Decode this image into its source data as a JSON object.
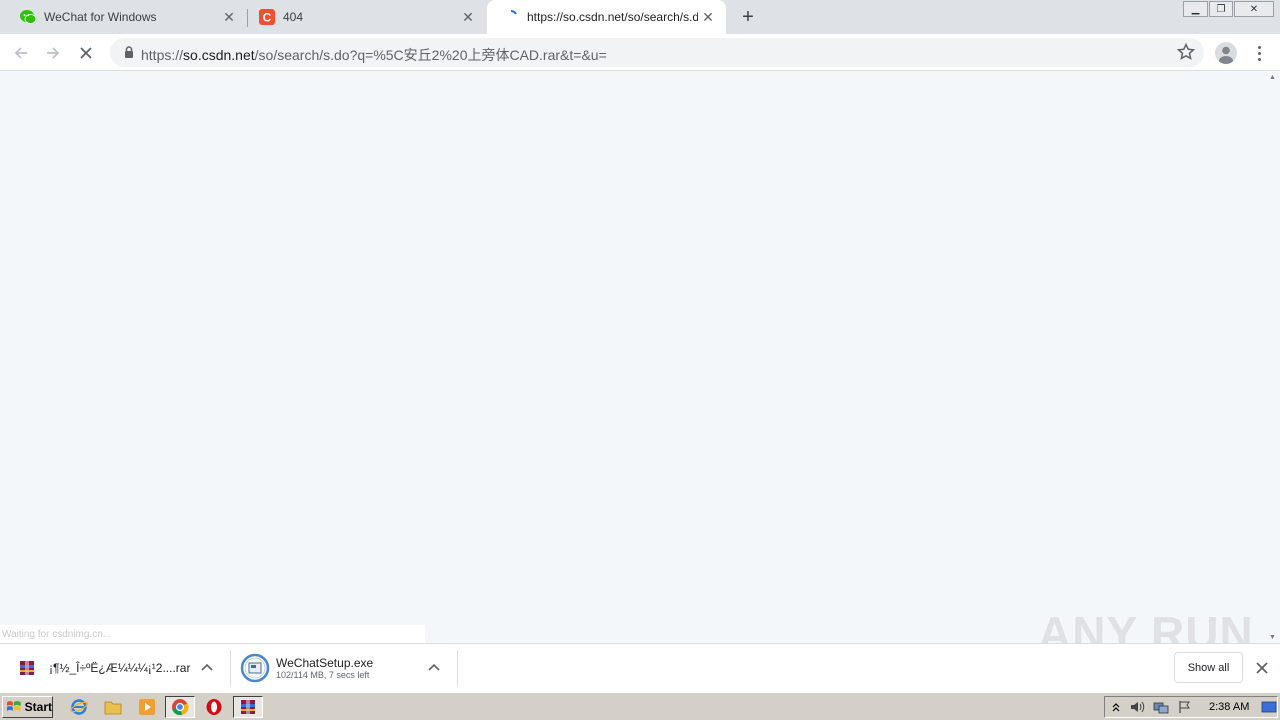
{
  "browser": {
    "tabs": [
      {
        "title": "WeChat for Windows",
        "favicon": "wechat-icon"
      },
      {
        "title": "404",
        "favicon": "csdn-icon"
      },
      {
        "title": "https://so.csdn.net/so/search/s.do?",
        "favicon": "loading-icon"
      }
    ],
    "address": {
      "scheme": "https://",
      "host": "so.csdn.net",
      "path": "/so/search/s.do?q=%5C安丘2%20上旁体CAD.rar&t=&u="
    },
    "status_text": "Waiting for csdnimg.cn..."
  },
  "downloads": {
    "items": [
      {
        "name": "¡¶½_Î÷ºË¿Æ¼¼¼¡¹2....rar",
        "sub": "",
        "icon": "winrar-icon"
      },
      {
        "name": "WeChatSetup.exe",
        "sub": "102/114 MB, 7 secs left",
        "icon": "installer-icon"
      }
    ],
    "show_all": "Show all"
  },
  "watermark": "ANY RUN",
  "taskbar": {
    "start_label": "Start",
    "clock": "2:38 AM"
  },
  "colors": {
    "tab_strip": "#dee1e6",
    "page_background": "#f4f7fa",
    "csdn_brand": "#f0502f",
    "wechat_green": "#2dc100",
    "taskbar": "#d4d0c8"
  }
}
